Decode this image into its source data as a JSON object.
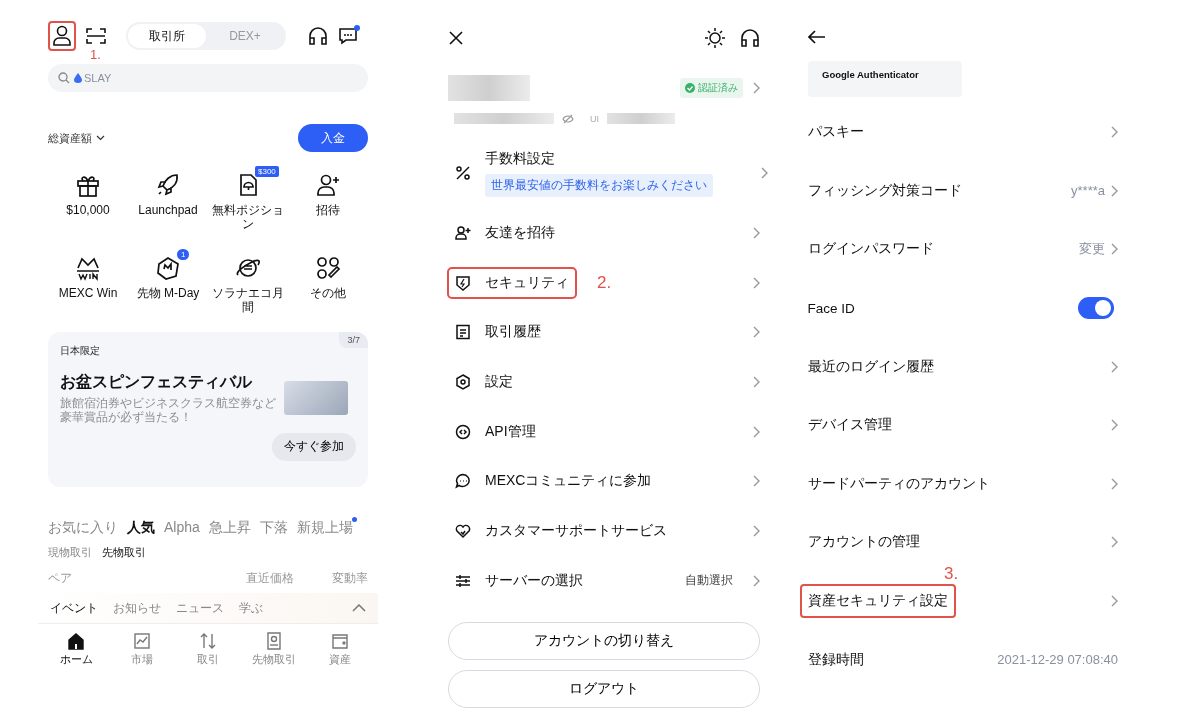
{
  "home": {
    "header": {
      "profile_highlighted": true,
      "step": "1.",
      "tabs": [
        {
          "label": "取引所",
          "selected": true
        },
        {
          "label": "DEX+",
          "selected": false
        }
      ],
      "messages_unread": true
    },
    "search": {
      "placeholder": "SLAY"
    },
    "total_assets_label": "総資産額",
    "deposit_button": "入金",
    "shortcuts": [
      {
        "label": "$10,000"
      },
      {
        "label": "Launchpad"
      },
      {
        "label": "無料ポジション",
        "badge": "$300"
      },
      {
        "label": "招待"
      },
      {
        "label": "MEXC Win"
      },
      {
        "label": "先物 M-Day",
        "badge": "1"
      },
      {
        "label": "ソラナエコ月間"
      },
      {
        "label": "その他"
      }
    ],
    "banner": {
      "tag": "日本限定",
      "counter": "3/7",
      "title": "お盆スピンフェスティバル",
      "description": "旅館宿泊券やビジネスクラス航空券など豪華賞品が必ず当たる！",
      "button": "今すぐ参加"
    },
    "market_tabs": [
      {
        "label": "お気に入り",
        "selected": false,
        "new_dot": false
      },
      {
        "label": "人気",
        "selected": true,
        "new_dot": false
      },
      {
        "label": "Alpha",
        "selected": false,
        "new_dot": false
      },
      {
        "label": "急上昇",
        "selected": false,
        "new_dot": false
      },
      {
        "label": "下落",
        "selected": false,
        "new_dot": false
      },
      {
        "label": "新規上場",
        "selected": false,
        "new_dot": true
      }
    ],
    "sub_tabs": [
      {
        "label": "現物取引",
        "selected": false
      },
      {
        "label": "先物取引",
        "selected": true
      }
    ],
    "columns": [
      "ペア",
      "直近価格",
      "変動率"
    ],
    "news_tabs": [
      {
        "label": "イベント",
        "selected": true
      },
      {
        "label": "お知らせ",
        "selected": false
      },
      {
        "label": "ニュース",
        "selected": false
      },
      {
        "label": "学ぶ",
        "selected": false
      }
    ],
    "bottom_nav": [
      {
        "label": "ホーム",
        "selected": true
      },
      {
        "label": "市場",
        "selected": false
      },
      {
        "label": "取引",
        "selected": false
      },
      {
        "label": "先物取引",
        "selected": false
      },
      {
        "label": "資産",
        "selected": false
      }
    ]
  },
  "menu": {
    "verified_badge": "認証済み",
    "uid_label": "UI",
    "items": [
      {
        "label": "手数料設定",
        "subtitle": "世界最安値の手数料をお楽しみください",
        "highlighted": false
      },
      {
        "label": "友達を招待",
        "highlighted": false
      },
      {
        "label": "セキュリティ",
        "highlighted": true,
        "step": "2."
      },
      {
        "label": "取引履歴",
        "highlighted": false
      },
      {
        "label": "設定",
        "highlighted": false
      },
      {
        "label": "API管理",
        "highlighted": false
      },
      {
        "label": "MEXCコミュニティに参加",
        "highlighted": false
      },
      {
        "label": "カスタマーサポートサービス",
        "highlighted": false
      },
      {
        "label": "サーバーの選択",
        "value": "自動選択",
        "highlighted": false
      }
    ],
    "buttons": [
      "アカウントの切り替え",
      "ログアウト"
    ]
  },
  "security": {
    "authenticator_card": "Google Authenticator",
    "rows": [
      {
        "kind": "link",
        "label": "パスキー",
        "highlighted": false
      },
      {
        "kind": "link",
        "label": "フィッシング対策コード",
        "value": "y****a",
        "highlighted": false
      },
      {
        "kind": "link",
        "label": "ログインパスワード",
        "value": "変更",
        "highlighted": false
      },
      {
        "kind": "toggle",
        "label": "Face ID",
        "on": true,
        "highlighted": false
      },
      {
        "kind": "link",
        "label": "最近のログイン履歴",
        "highlighted": false
      },
      {
        "kind": "link",
        "label": "デバイス管理",
        "highlighted": false
      },
      {
        "kind": "link",
        "label": "サードパーティのアカウント",
        "highlighted": false
      },
      {
        "kind": "link",
        "label": "アカウントの管理",
        "highlighted": false
      },
      {
        "kind": "link",
        "label": "資産セキュリティ設定",
        "highlighted": true,
        "step": "3."
      },
      {
        "kind": "info",
        "label": "登録時間",
        "value": "2021-12-29 07:08:40",
        "highlighted": false
      }
    ]
  }
}
